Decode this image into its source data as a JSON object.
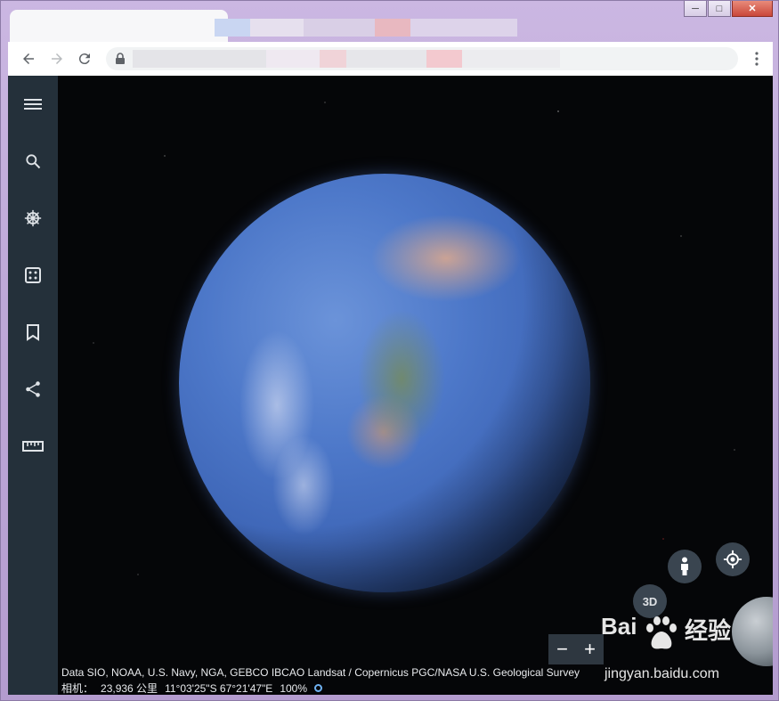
{
  "browser": {
    "tab_title": "",
    "url": "",
    "window_controls": {
      "minimize": "─",
      "maximize": "□",
      "close": "✕"
    }
  },
  "sidebar": {
    "items": [
      {
        "icon": "menu-icon"
      },
      {
        "icon": "search-icon"
      },
      {
        "icon": "voyager-wheel-icon"
      },
      {
        "icon": "dice-icon"
      },
      {
        "icon": "bookmark-icon"
      },
      {
        "icon": "share-icon"
      },
      {
        "icon": "ruler-icon"
      }
    ]
  },
  "map_controls": {
    "three_d_label": "3D",
    "zoom_out": "−",
    "zoom_in": "+"
  },
  "footer": {
    "attribution": "Data SIO, NOAA, U.S. Navy, NGA, GEBCO IBCAO Landsat / Copernicus PGC/NASA U.S. Geological Survey",
    "camera_label": "相机：",
    "camera_distance": "23,936 公里",
    "coordinates": "11°03'25\"S 67°21'47\"E",
    "zoom_percent": "100%"
  },
  "watermark": {
    "text": "Bai",
    "text2": "经验",
    "url": "jingyan.baidu.com"
  },
  "colors": {
    "sidebar": "#24303a",
    "space": "#050608",
    "ocean": "#4d78c9",
    "accent": "#6fb1f1"
  }
}
